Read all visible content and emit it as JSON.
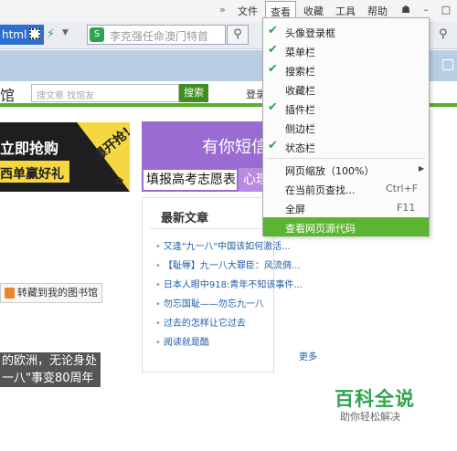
{
  "menubar": {
    "overflow": "»",
    "items": [
      "文件",
      "查看",
      "收藏",
      "工具",
      "帮助"
    ],
    "active": "查看"
  },
  "toolbar": {
    "address_text": "html",
    "search_placeholder": "李克强任命澳门特首"
  },
  "site": {
    "title_partial": "馆",
    "search_placeholder": "搜文章 找馆友",
    "search_button": "搜索",
    "login": "登录"
  },
  "promo": {
    "line1": "立即抢购",
    "line2": "西单赢好礼",
    "hot": "火爆开抢!"
  },
  "save_button": "转藏到我的图书馆",
  "dark_text": [
    "的欧洲，无论身处",
    "一八\"事变80周年"
  ],
  "ad": {
    "headline": "有你短信",
    "left_box": "填报高考志愿表",
    "right_box": "心理"
  },
  "articles": {
    "heading": "最新文章",
    "items": [
      "又逢\"九一八\"中国该如何激活...",
      "【耻辱】九一八大罪臣：风流倜...",
      "日本人眼中918:青年不知该事件...",
      "勿忘国耻——勿忘九一八",
      "过去的怎样让它过去",
      "阅读就是酷"
    ],
    "more": "更多"
  },
  "brand": {
    "name": "百科全说",
    "tagline": "助你轻松解决"
  },
  "view_menu": {
    "items": [
      {
        "label": "头像登录框",
        "checked": true
      },
      {
        "label": "菜单栏",
        "checked": true
      },
      {
        "label": "搜索栏",
        "checked": true
      },
      {
        "label": "收藏栏",
        "checked": false
      },
      {
        "label": "插件栏",
        "checked": true
      },
      {
        "label": "侧边栏",
        "checked": false
      },
      {
        "label": "状态栏",
        "checked": true
      }
    ],
    "zoom": {
      "label": "网页缩放（100%）"
    },
    "find": {
      "label": "在当前页查找...",
      "shortcut": "Ctrl+F"
    },
    "fullscreen": {
      "label": "全屏",
      "shortcut": "F11"
    },
    "view_source": {
      "label": "查看网页源代码"
    }
  },
  "colors": {
    "brand_green": "#2ea44f",
    "highlight_green": "#5cb531",
    "site_green": "#59ae2a",
    "ad_purple": "#9a6bd0"
  }
}
